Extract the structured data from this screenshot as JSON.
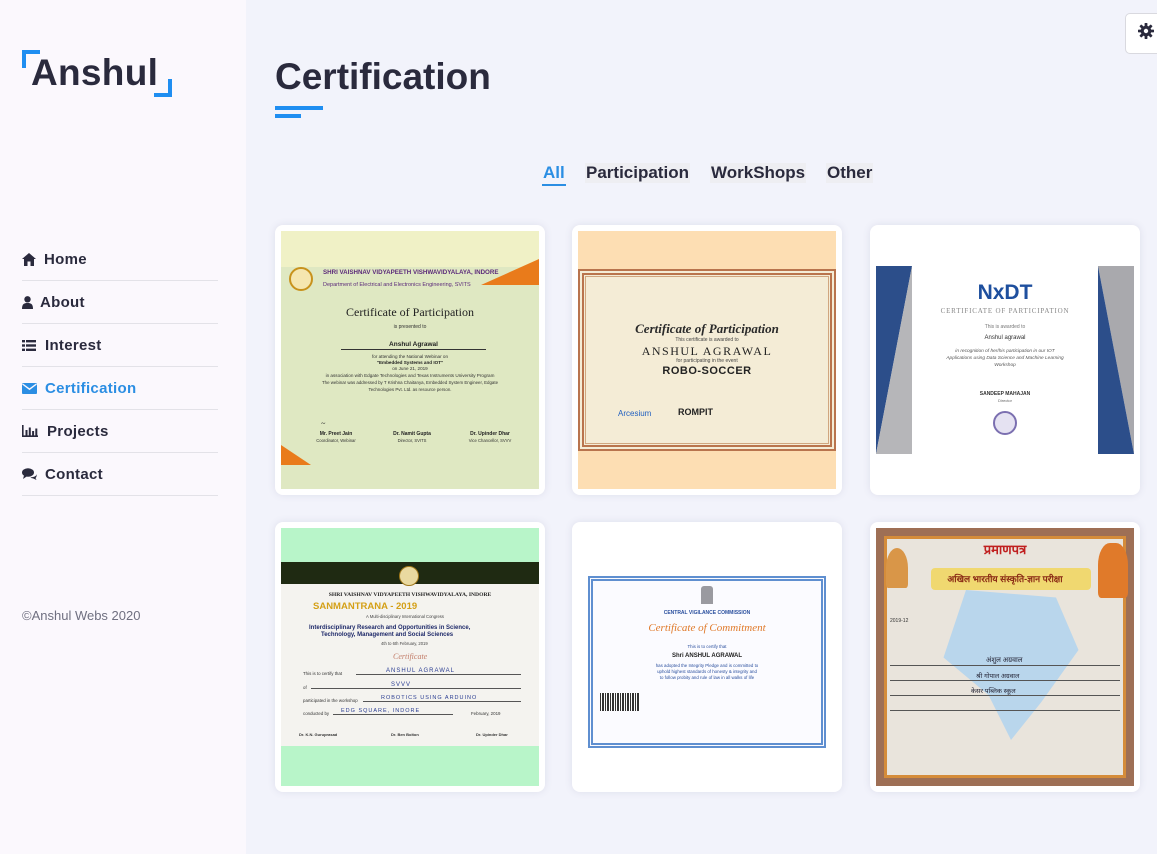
{
  "sidebar": {
    "logo": "Anshul",
    "nav": [
      {
        "label": "Home",
        "icon": "home-icon"
      },
      {
        "label": "About",
        "icon": "user-icon"
      },
      {
        "label": "Interest",
        "icon": "list-icon"
      },
      {
        "label": "Certification",
        "icon": "envelope-icon",
        "active": true
      },
      {
        "label": "Projects",
        "icon": "bar-chart-icon"
      },
      {
        "label": "Contact",
        "icon": "comments-icon"
      }
    ],
    "copyright": "©Anshul Webs 2020"
  },
  "main": {
    "title": "Certification",
    "filters": [
      "All",
      "Participation",
      "WorkShops",
      "Other"
    ],
    "active_filter": "All"
  },
  "settings_icon": "gear-icon",
  "colors": {
    "accent": "#1f8ef1",
    "text": "#2a2a3d",
    "sidebar_bg": "#fbf8fd",
    "main_bg": "#f2f3fb"
  },
  "certificates": [
    {
      "university": "SHRI VAISHNAV VIDYAPEETH VISHWAVIDYALAYA, INDORE",
      "department": "Department of Electrical and Electronics Engineering, SVITS",
      "heading": "Certificate of Participation",
      "presented": "is presented to",
      "name": "Anshul Agrawal",
      "line1": "for attending the National Webinar on",
      "line2": "\"Embedded Systems and IOT\"",
      "line3": "on June 21, 2019",
      "line4": "in association with Edgate Technologies and Texas Instruments University Program",
      "line5": "The webinar was addressed by T Krishna Chaitanya, Embedded System Engineer, Edgate",
      "line6": "Technologies Pvt. Ltd. as resource person.",
      "signatories": [
        {
          "name": "Mr. Preet Jain",
          "role": "Coordinator, Webinar"
        },
        {
          "name": "Dr. Namit Gupta",
          "role": "Director, SVITS"
        },
        {
          "name": "Dr. Upinder Dhar",
          "role": "Vice Chancellor, SVVV"
        }
      ]
    },
    {
      "heading": "Certificate of Participation",
      "awarded": "This certificate is awarded to",
      "name": "ANSHUL AGRAWAL",
      "for": "for participating in the event",
      "event": "ROBO-SOCCER",
      "logos": [
        "Arcesium",
        "ROMPIT"
      ]
    },
    {
      "brand": "NxDT",
      "heading": "CERTIFICATE OF PARTICIPATION",
      "awarded": "This is awarded to",
      "name": "Anshul agrawal",
      "line1": "in recognition of her/his participation in our IOT",
      "line2": "Applications using Data Science and Machine Learning",
      "line3": "Workshop",
      "signer": "SANDEEP MAHAJAN",
      "signer_role": "Director"
    },
    {
      "university": "SHRI VAISHNAV VIDYAPEETH VISHWAVIDYALAYA, INDORE",
      "event": "SANMANTRANA - 2019",
      "line1": "A Multi-disciplinary International Congress",
      "line2": "Interdisciplinary Research and Opportunities in Science,",
      "line3": "Technology, Management and Social Sciences",
      "line4": "4th to 6th February, 2019",
      "heading": "Certificate",
      "certify": "This is to certify that",
      "name": "ANSHUL AGRAWAL",
      "of": "of",
      "org": "SVVV",
      "workshop_label": "participated in the workshop",
      "workshop": "ROBOTICS USING ARDUINO",
      "conducted_label": "conducted by",
      "conducted": "EDG SQUARE, INDORE",
      "date_suffix": "February, 2019",
      "signatories": [
        "Dr. K.N. Guruprasad",
        "Dr. Ben Bolton",
        "Dr. Upinder Dhar"
      ]
    },
    {
      "commission": "CENTRAL VIGILANCE COMMISSION",
      "heading": "Certificate of Commitment",
      "certify": "This is to certify that",
      "name": "Shri ANSHUL AGRAWAL",
      "line1": "has adopted the Integrity Pledge and is committed to",
      "line2": "uphold highest standards of honesty & integrity and",
      "line3": "to follow probity and rule of law in all walks of life"
    },
    {
      "heading": "प्रमाणपत्र",
      "banner": "अखिल भारतीय संस्कृति-ज्ञान परीक्षा",
      "name": "अंशुल अग्रवाल",
      "father": "श्री गोपाल अग्रवाल",
      "school": "केसर पब्लिक स्कूल",
      "year": "2019-12"
    }
  ]
}
